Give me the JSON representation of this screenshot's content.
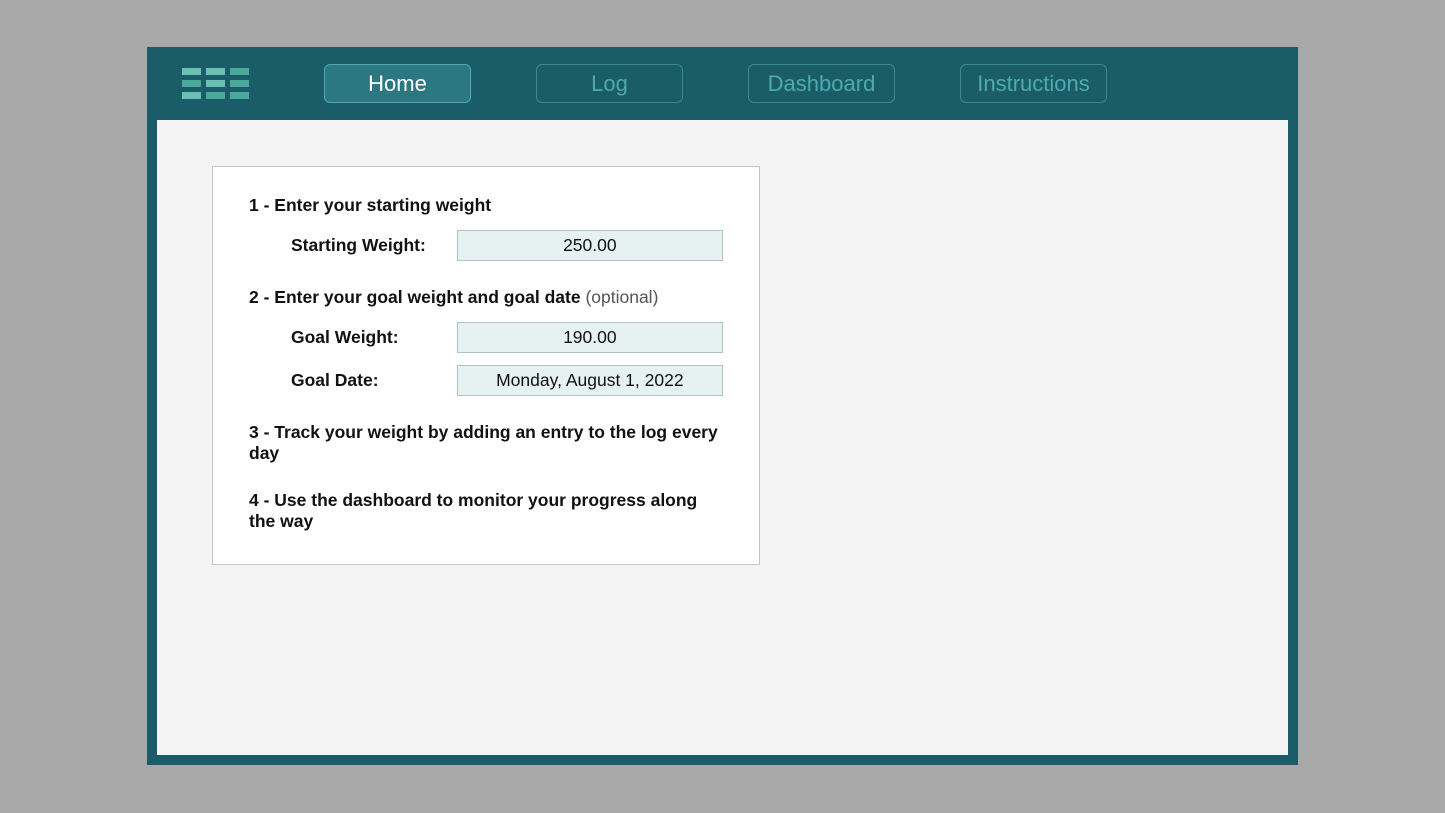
{
  "nav": {
    "home": "Home",
    "log": "Log",
    "dashboard": "Dashboard",
    "instructions": "Instructions"
  },
  "steps": {
    "s1_heading": "1 - Enter your starting weight",
    "s2_heading": "2 - Enter your goal weight and goal date",
    "s2_optional": "  (optional)",
    "s3_heading": "3 - Track your weight by adding an entry to the log every day",
    "s4_heading": "4 - Use the dashboard to monitor your progress along the way"
  },
  "fields": {
    "starting_weight_label": "Starting Weight:",
    "starting_weight_value": "250.00",
    "goal_weight_label": "Goal Weight:",
    "goal_weight_value": "190.00",
    "goal_date_label": "Goal Date:",
    "goal_date_value": "Monday, August 1, 2022"
  }
}
